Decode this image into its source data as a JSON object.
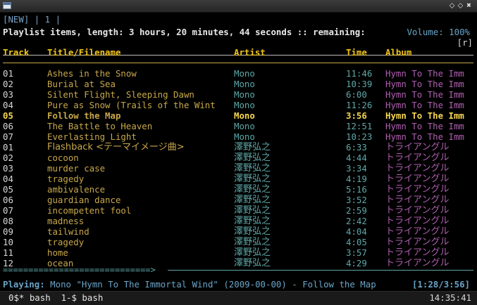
{
  "window": {
    "buttons": [
      "⬦",
      "⬦",
      "✖"
    ]
  },
  "top_tabs": "[NEW] | 1 |",
  "playlist_info": "Playlist items, length: 3 hours, 20 minutes, 44 seconds :: remaining:",
  "volume": "Volume: 100%",
  "repeat_flag": "[r]",
  "columns": {
    "track": "Track",
    "title": "Title/Filename",
    "artist": "Artist",
    "time": "Time",
    "album": "Album"
  },
  "rows": [
    {
      "track": "01",
      "title": "Ashes in the Snow",
      "artist": "Mono",
      "time": "11:46",
      "album": "Hymn To The Imm",
      "current": false
    },
    {
      "track": "02",
      "title": "Burial at Sea",
      "artist": "Mono",
      "time": "10:39",
      "album": "Hymn To The Imm",
      "current": false
    },
    {
      "track": "03",
      "title": "Silent Flight, Sleeping Dawn",
      "artist": "Mono",
      "time": "6:00",
      "album": "Hymn To The Imm",
      "current": false
    },
    {
      "track": "04",
      "title": "Pure as Snow (Trails of the Wint",
      "artist": "Mono",
      "time": "11:26",
      "album": "Hymn To The Imm",
      "current": false
    },
    {
      "track": "05",
      "title": "Follow the Map",
      "artist": "Mono",
      "time": "3:56",
      "album": "Hymn To The Imm",
      "current": true
    },
    {
      "track": "06",
      "title": "The Battle to Heaven",
      "artist": "Mono",
      "time": "12:51",
      "album": "Hymn To The Imm",
      "current": false
    },
    {
      "track": "07",
      "title": "Everlasting Light",
      "artist": "Mono",
      "time": "10:23",
      "album": "Hymn To The Imm",
      "current": false
    },
    {
      "track": "01",
      "title": "Flashback <テーマイメージ曲>",
      "artist": "澤野弘之",
      "time": "6:33",
      "album": "トライアングル",
      "current": false
    },
    {
      "track": "02",
      "title": "cocoon",
      "artist": "澤野弘之",
      "time": "4:44",
      "album": "トライアングル",
      "current": false
    },
    {
      "track": "03",
      "title": "murder case",
      "artist": "澤野弘之",
      "time": "3:34",
      "album": "トライアングル",
      "current": false
    },
    {
      "track": "04",
      "title": "tragedy",
      "artist": "澤野弘之",
      "time": "4:19",
      "album": "トライアングル",
      "current": false
    },
    {
      "track": "05",
      "title": "ambivalence",
      "artist": "澤野弘之",
      "time": "5:16",
      "album": "トライアングル",
      "current": false
    },
    {
      "track": "06",
      "title": "guardian dance",
      "artist": "澤野弘之",
      "time": "3:52",
      "album": "トライアングル",
      "current": false
    },
    {
      "track": "07",
      "title": "incompetent fool",
      "artist": "澤野弘之",
      "time": "2:59",
      "album": "トライアングル",
      "current": false
    },
    {
      "track": "08",
      "title": "madness",
      "artist": "澤野弘之",
      "time": "2:42",
      "album": "トライアングル",
      "current": false
    },
    {
      "track": "09",
      "title": "tailwind",
      "artist": "澤野弘之",
      "time": "4:04",
      "album": "トライアングル",
      "current": false
    },
    {
      "track": "10",
      "title": "tragedy",
      "artist": "澤野弘之",
      "time": "4:05",
      "album": "トライアングル",
      "current": false
    },
    {
      "track": "11",
      "title": "home",
      "artist": "澤野弘之",
      "time": "3:57",
      "album": "トライアングル",
      "current": false
    },
    {
      "track": "12",
      "title": "ocean",
      "artist": "澤野弘之",
      "time": "4:29",
      "album": "トライアングル",
      "current": false
    }
  ],
  "progress_bar": "=============================>",
  "playback_progress": 0.34,
  "now_playing": {
    "label": "Playing:",
    "text": "Mono \"Hymn To The Immortal Wind\" (2009-00-00) - Follow the Map",
    "elapsed_total": "[1:28/3:56]"
  },
  "statusbar": {
    "windows": "0$* bash  1-$ bash",
    "clock": "14:35:41"
  }
}
